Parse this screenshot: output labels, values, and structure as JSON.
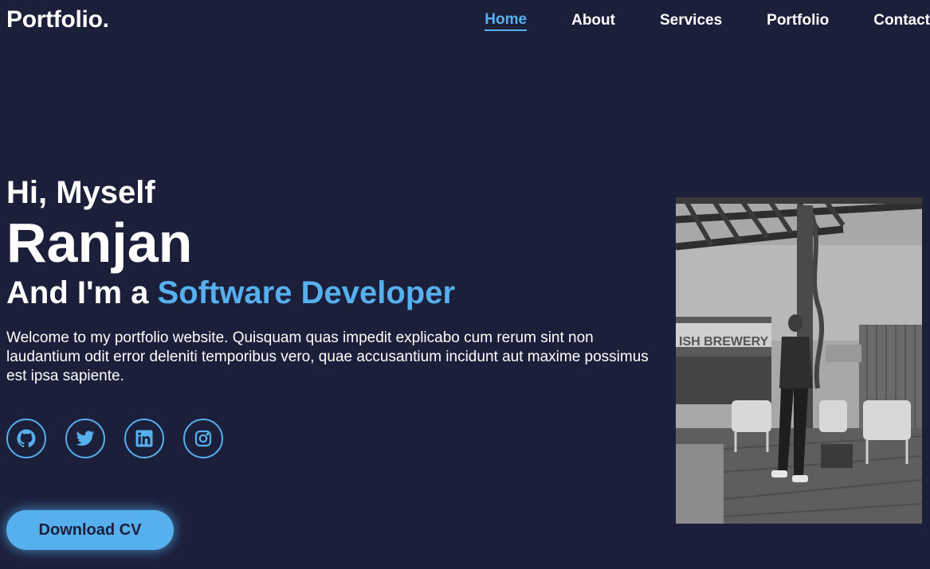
{
  "header": {
    "logo": "Portfolio."
  },
  "nav": {
    "items": [
      {
        "label": "Home",
        "active": true
      },
      {
        "label": "About",
        "active": false
      },
      {
        "label": "Services",
        "active": false
      },
      {
        "label": "Portfolio",
        "active": false
      },
      {
        "label": "Contact",
        "active": false
      }
    ]
  },
  "hero": {
    "greeting": "Hi, Myself",
    "name": "Ranjan",
    "role_prefix": "And I'm a",
    "role_highlight": "Software Developer",
    "intro": "Welcome to my portfolio website. Quisquam quas impedit explicabo cum rerum sint non laudantium odit error deleniti temporibus vero, quae accusantium incidunt aut maxime possimus est ipsa sapiente.",
    "social_icons": [
      "github-icon",
      "twitter-icon",
      "linkedin-icon",
      "instagram-icon"
    ],
    "cv_button": "Download CV",
    "photo_sign": "ISH BREWERY"
  },
  "colors": {
    "background": "#1b1f3a",
    "accent": "#56b0ee",
    "text": "#ffffff"
  }
}
